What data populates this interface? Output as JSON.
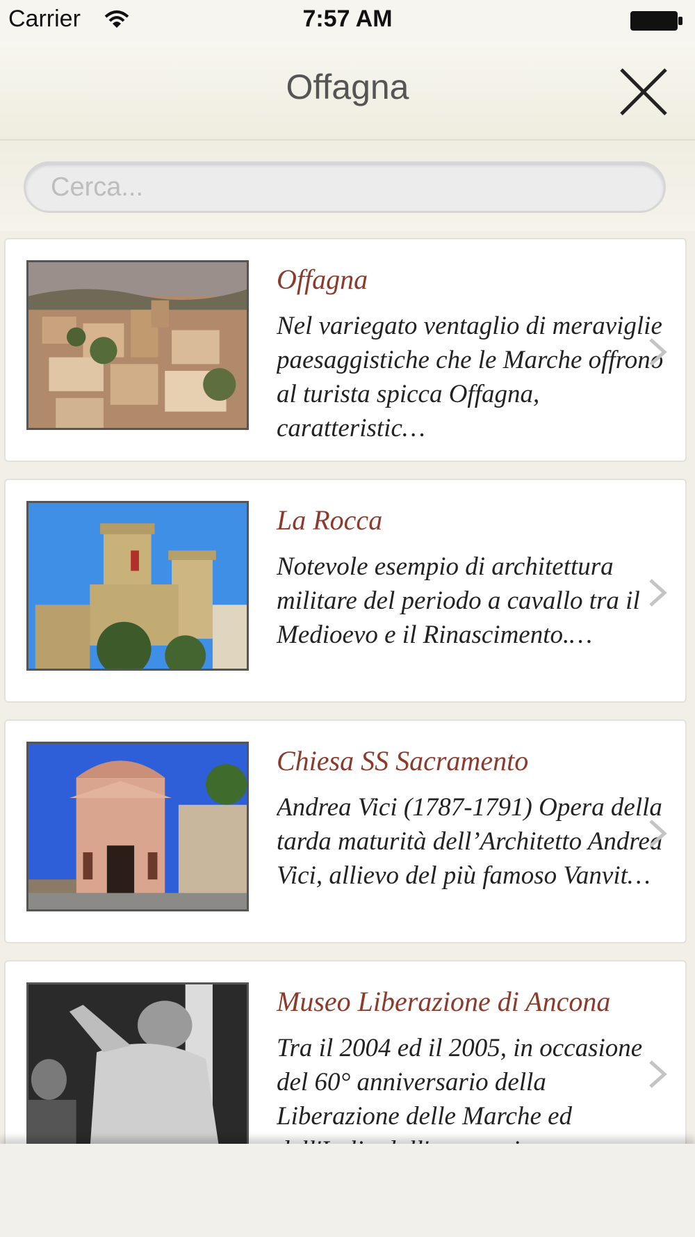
{
  "status_bar": {
    "carrier": "Carrier",
    "time": "7:57 AM",
    "wifi_icon": "wifi-icon",
    "battery_icon": "battery-full-icon"
  },
  "nav": {
    "title": "Offagna",
    "close_icon": "close-icon"
  },
  "search": {
    "placeholder": "Cerca...",
    "value": ""
  },
  "items": [
    {
      "title": "Offagna",
      "description": "Nel variegato ventaglio di meraviglie paesaggistiche che le Marche offrono al turista spicca Offagna, caratteristic…",
      "image": "town-photo"
    },
    {
      "title": "La Rocca",
      "description": "Notevole esempio di architettura militare del periodo a cavallo tra il Medioevo e il Rinascimento.…",
      "image": "castle-photo"
    },
    {
      "title": "Chiesa SS Sacramento",
      "description": "Andrea Vici (1787-1791) Opera della tarda maturità dell’Architetto Andrea Vici, allievo del più famoso Vanvit…",
      "image": "church-photo"
    },
    {
      "title": "Museo Liberazione di Ancona",
      "description": "Tra il 2004 ed il 2005, in occasione del 60° anniversario della Liberazione delle Marche ed dell'Italia dall'occupazione",
      "image": "soldier-photo"
    }
  ],
  "colors": {
    "title_accent": "#8b3a2b",
    "background": "#f4f2e8"
  }
}
